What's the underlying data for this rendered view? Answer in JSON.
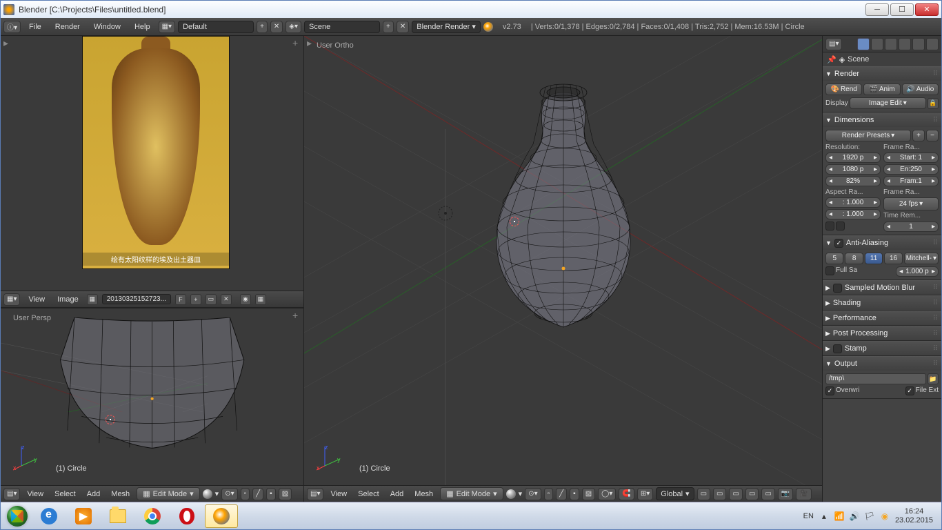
{
  "window": {
    "title": "Blender [C:\\Projects\\Files\\untitled.blend]"
  },
  "topmenu": {
    "items": [
      "File",
      "Render",
      "Window",
      "Help"
    ],
    "layout": "Default",
    "scene": "Scene",
    "engine": "Blender Render",
    "version": "v2.73",
    "stats": "Verts:0/1,378 | Edges:0/2,784 | Faces:0/1,408 | Tris:2,752 | Mem:16.53M | Circle"
  },
  "viewports": {
    "main": {
      "label": "User Ortho",
      "object": "(1) Circle"
    },
    "left_bottom": {
      "label": "User Persp",
      "object": "(1) Circle"
    },
    "ref_caption": "绘有太阳纹样的埃及出土器皿"
  },
  "image_editor": {
    "menus": [
      "View",
      "Image"
    ],
    "filename": "20130325152723...",
    "f_button": "F"
  },
  "header3d": {
    "menus": [
      "View",
      "Select",
      "Add",
      "Mesh"
    ],
    "mode": "Edit Mode",
    "orientation": "Global"
  },
  "properties": {
    "breadcrumb": "Scene",
    "render": {
      "title": "Render",
      "buttons": {
        "render": "Rend",
        "anim": "Anim",
        "audio": "Audio"
      },
      "display_label": "Display",
      "display_value": "Image Edit"
    },
    "dimensions": {
      "title": "Dimensions",
      "presets": "Render Presets",
      "resolution_label": "Resolution:",
      "frame_range_label": "Frame Ra...",
      "res_x": "1920 p",
      "res_y": "1080 p",
      "percent": "82%",
      "start": "Start: 1",
      "end": "En:250",
      "frame": "Fram:1",
      "aspect_label": "Aspect Ra...",
      "frame_rate_label": "Frame Ra...",
      "aspect_x": ": 1.000",
      "aspect_y": ": 1.000",
      "fps": "24 fps",
      "time_rem": "Time Rem...",
      "old": "1",
      "new": "1"
    },
    "antialias": {
      "title": "Anti-Aliasing",
      "samples": [
        "5",
        "8",
        "11",
        "16"
      ],
      "selected": "11",
      "filter": "Mitchell-",
      "fullsample": "Full Sa",
      "size": "1.000 p"
    },
    "motionblur": {
      "title": "Sampled Motion Blur"
    },
    "shading": {
      "title": "Shading"
    },
    "performance": {
      "title": "Performance"
    },
    "postprocess": {
      "title": "Post Processing"
    },
    "stamp": {
      "title": "Stamp"
    },
    "output": {
      "title": "Output",
      "path": "/tmp\\",
      "overwrite": "Overwri",
      "file_ext": "File Ext"
    }
  },
  "taskbar": {
    "lang": "EN",
    "time": "16:24",
    "date": "23.02.2015"
  }
}
